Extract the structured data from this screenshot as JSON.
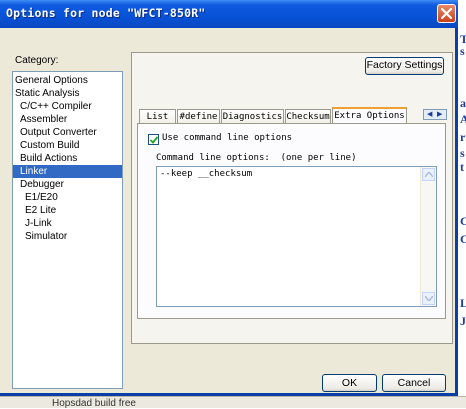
{
  "window": {
    "title": "Options for node \"WFCT-850R\""
  },
  "category": {
    "label": "Category:",
    "items": [
      {
        "label": "General Options",
        "indent": 0
      },
      {
        "label": "Static Analysis",
        "indent": 0
      },
      {
        "label": "C/C++ Compiler",
        "indent": 1
      },
      {
        "label": "Assembler",
        "indent": 1
      },
      {
        "label": "Output Converter",
        "indent": 1
      },
      {
        "label": "Custom Build",
        "indent": 1
      },
      {
        "label": "Build Actions",
        "indent": 1
      },
      {
        "label": "Linker",
        "indent": 1,
        "selected": true
      },
      {
        "label": "Debugger",
        "indent": 1
      },
      {
        "label": "E1/E20",
        "indent": 2
      },
      {
        "label": "E2 Lite",
        "indent": 2
      },
      {
        "label": "J-Link",
        "indent": 2
      },
      {
        "label": "Simulator",
        "indent": 2
      }
    ]
  },
  "buttons": {
    "factory_settings": "Factory Settings",
    "ok": "OK",
    "cancel": "Cancel"
  },
  "tabs": [
    {
      "label": "List"
    },
    {
      "label": "#define"
    },
    {
      "label": "Diagnostics"
    },
    {
      "label": "Checksum"
    },
    {
      "label": "Extra Options",
      "active": true
    }
  ],
  "extra_options": {
    "use_cmd_label": "Use command line options",
    "use_cmd_checked": true,
    "cmd_label": "Command line options:  (one per line)",
    "cmd_value": "--keep __checksum"
  },
  "background": {
    "bottom_text": "Hopsdad build free",
    "edge_chars": [
      "T",
      "s",
      "a",
      "A",
      "r",
      "s",
      "t",
      "C",
      "C",
      "L",
      "J"
    ]
  },
  "colors": {
    "titlebar": "#0752d6",
    "selection": "#316ac5",
    "dialog_face": "#ece9d8",
    "active_tab_accent": "#f0a030"
  }
}
